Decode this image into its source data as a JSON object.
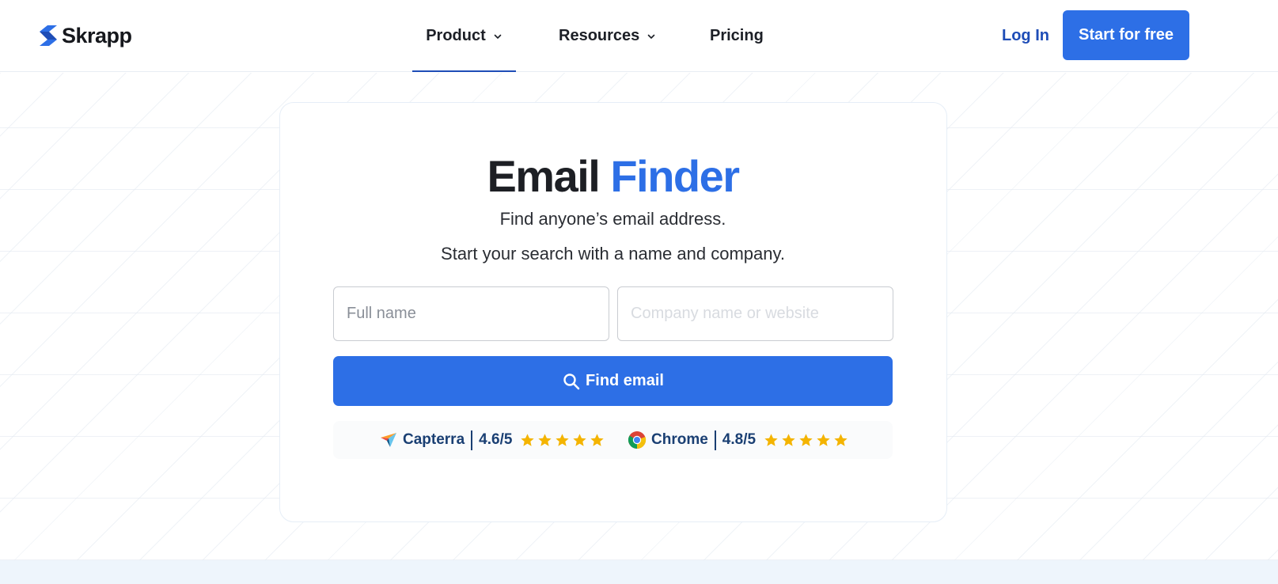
{
  "brand": {
    "name": "Skrapp",
    "logo_icon": "skrapp-logo-icon"
  },
  "nav": {
    "items": [
      {
        "label": "Product",
        "has_dropdown": true,
        "active": true
      },
      {
        "label": "Resources",
        "has_dropdown": true,
        "active": false
      },
      {
        "label": "Pricing",
        "has_dropdown": false,
        "active": false
      }
    ],
    "login_label": "Log In",
    "cta_label": "Start for free"
  },
  "hero": {
    "title_part1": "Email",
    "title_part2": "Finder",
    "subtitle1": "Find anyone’s email address.",
    "subtitle2": "Start your search with a name and company."
  },
  "form": {
    "full_name": {
      "value": "",
      "placeholder": "Full name"
    },
    "company": {
      "value": "",
      "placeholder": "Company name or website"
    },
    "submit_label": "Find email",
    "submit_icon": "search-icon"
  },
  "ratings": [
    {
      "platform": "Capterra",
      "score": "4.6/5",
      "stars": 5,
      "icon": "capterra-icon"
    },
    {
      "platform": "Chrome",
      "score": "4.8/5",
      "stars": 5,
      "icon": "chrome-icon"
    }
  ],
  "colors": {
    "primary": "#2d6fe6",
    "nav_active": "#1e4db7",
    "text_dark": "#1d1f24",
    "rating_text": "#1a3f73",
    "star": "#f4b400"
  }
}
